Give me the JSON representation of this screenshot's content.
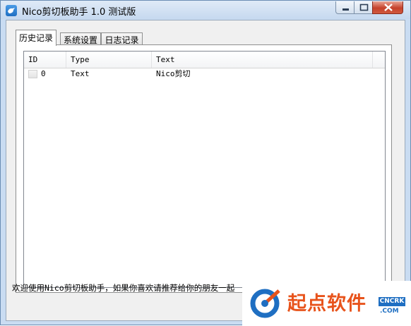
{
  "window": {
    "title": "Nico剪切板助手 1.0 测试版",
    "accent": "#c9dcf2"
  },
  "tabs": [
    {
      "label": "历史记录",
      "active": true
    },
    {
      "label": "系统设置",
      "active": false
    },
    {
      "label": "日志记录",
      "active": false
    }
  ],
  "list": {
    "columns": [
      "ID",
      "Type",
      "Text"
    ],
    "rows": [
      {
        "id": "0",
        "type": "Text",
        "text": "Nico剪切"
      }
    ]
  },
  "status": {
    "message": "欢迎使用Nico剪切板助手，如果你喜欢请推荐给你的朋友一起"
  },
  "watermark": {
    "brand": "起点软件",
    "badge": "CNCRK",
    "domain": ".COM"
  }
}
